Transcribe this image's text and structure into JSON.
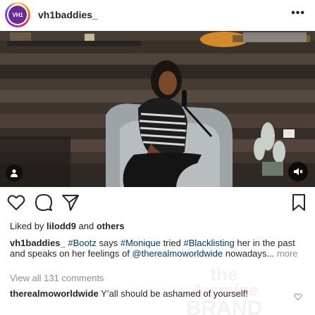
{
  "header": {
    "avatar_text": "VH1",
    "username": "vh1baddies_",
    "more_label": "•••"
  },
  "media": {
    "type": "video",
    "description_icons": [
      "user-tag-icon",
      "volume-off-icon"
    ]
  },
  "actions": {
    "icons": [
      "heart-icon",
      "comment-icon",
      "share-icon",
      "bookmark-icon"
    ]
  },
  "likes": {
    "prefix": "Liked by ",
    "user": "lilodd9",
    "conjunction": " and ",
    "others": "others"
  },
  "caption": {
    "user": "vh1baddies_",
    "segments": [
      {
        "text": " ",
        "tag": false
      },
      {
        "text": "#Bootz",
        "tag": true
      },
      {
        "text": " says ",
        "tag": false
      },
      {
        "text": "#Monique",
        "tag": true
      },
      {
        "text": " tried ",
        "tag": false
      },
      {
        "text": "#Blacklisting",
        "tag": true
      },
      {
        "text": " her in the past and speaks on her feelings of ",
        "tag": false
      },
      {
        "text": "@therealmoworldwide",
        "tag": true
      },
      {
        "text": " nowadays...",
        "tag": false
      }
    ],
    "more": "more"
  },
  "comments_link": "View all 131 comments",
  "comment": {
    "user": "therealmoworldwide",
    "text": " Y’all should be ashamed of yourself!"
  },
  "watermark": {
    "line1": "the",
    "line2": "Jasmine",
    "line3": "BRAND"
  },
  "colors": {
    "text": "#262626",
    "link": "#00376b",
    "muted": "#8e8e8e",
    "brand_purple": "#6a2c91"
  }
}
